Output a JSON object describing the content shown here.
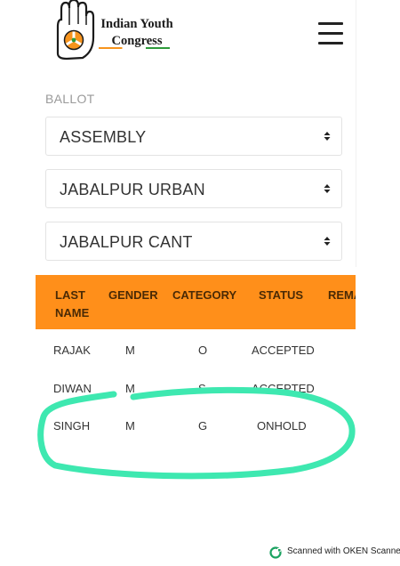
{
  "header": {
    "logo_line1": "Indian Youth",
    "logo_line2": "Congress"
  },
  "ballot": {
    "label": "BALLOT",
    "selects": [
      {
        "value": "ASSEMBLY"
      },
      {
        "value": "JABALPUR URBAN"
      },
      {
        "value": "JABALPUR CANT"
      }
    ]
  },
  "table": {
    "headers": [
      "LAST NAME",
      "GENDER",
      "CATEGORY",
      "STATUS",
      "REMA"
    ],
    "rows": [
      {
        "last_name": "RAJAK",
        "gender": "M",
        "category": "O",
        "status": "ACCEPTED"
      },
      {
        "last_name": "DIWAN",
        "gender": "M",
        "category": "S",
        "status": "ACCEPTED"
      },
      {
        "last_name": "SINGH",
        "gender": "M",
        "category": "G",
        "status": "ONHOLD"
      }
    ]
  },
  "colors": {
    "table_header": "#ff8f1a",
    "highlight_marker": "#3ee8b0"
  },
  "footer": {
    "text": "Scanned with OKEN Scanner"
  }
}
